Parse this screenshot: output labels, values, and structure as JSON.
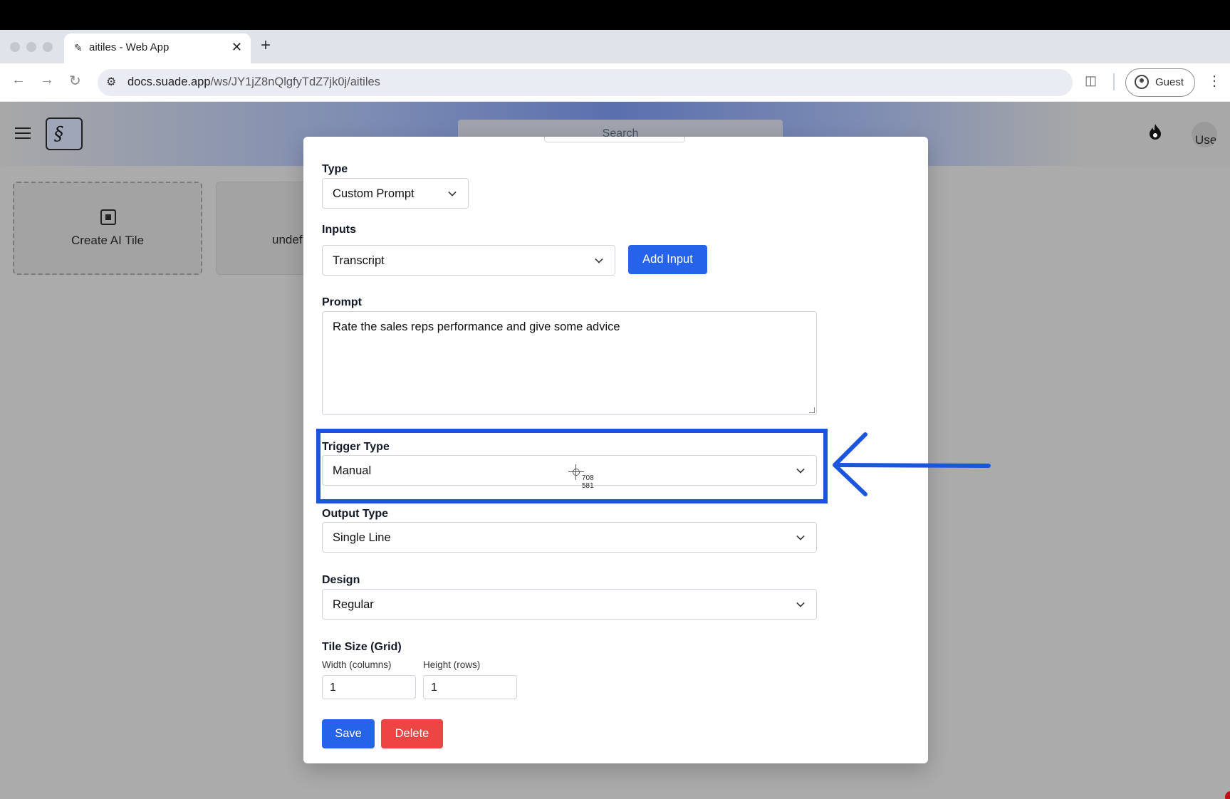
{
  "browser": {
    "tab_favicon": "✎",
    "tab_title": "aitiles - Web App",
    "tab_close": "✕",
    "new_tab": "+",
    "url_host": "docs.suade.app",
    "url_path": "/ws/JY1jZ8nQlgfyTdZ7jk0j/aitiles",
    "profile_label": "Guest"
  },
  "app": {
    "search_placeholder": "Search",
    "avatar_alt": "Use",
    "tiles": [
      {
        "label": "Create AI Tile"
      },
      {
        "label": "undef"
      }
    ]
  },
  "modal": {
    "type": {
      "label": "Type",
      "value": "Custom Prompt"
    },
    "inputs": {
      "label": "Inputs",
      "value": "Transcript",
      "add_button": "Add Input"
    },
    "prompt": {
      "label": "Prompt",
      "value": "Rate the sales reps performance and give some advice"
    },
    "trigger_type": {
      "label": "Trigger Type",
      "value": "Manual"
    },
    "output_type": {
      "label": "Output Type",
      "value": "Single Line"
    },
    "design": {
      "label": "Design",
      "value": "Regular"
    },
    "tile_size": {
      "label": "Tile Size (Grid)",
      "width_label": "Width (columns)",
      "width_value": "1",
      "height_label": "Height (rows)",
      "height_value": "1"
    },
    "save_button": "Save",
    "delete_button": "Delete"
  },
  "annotation": {
    "color": "#1a56db",
    "cursor_x": "708",
    "cursor_y": "581"
  }
}
